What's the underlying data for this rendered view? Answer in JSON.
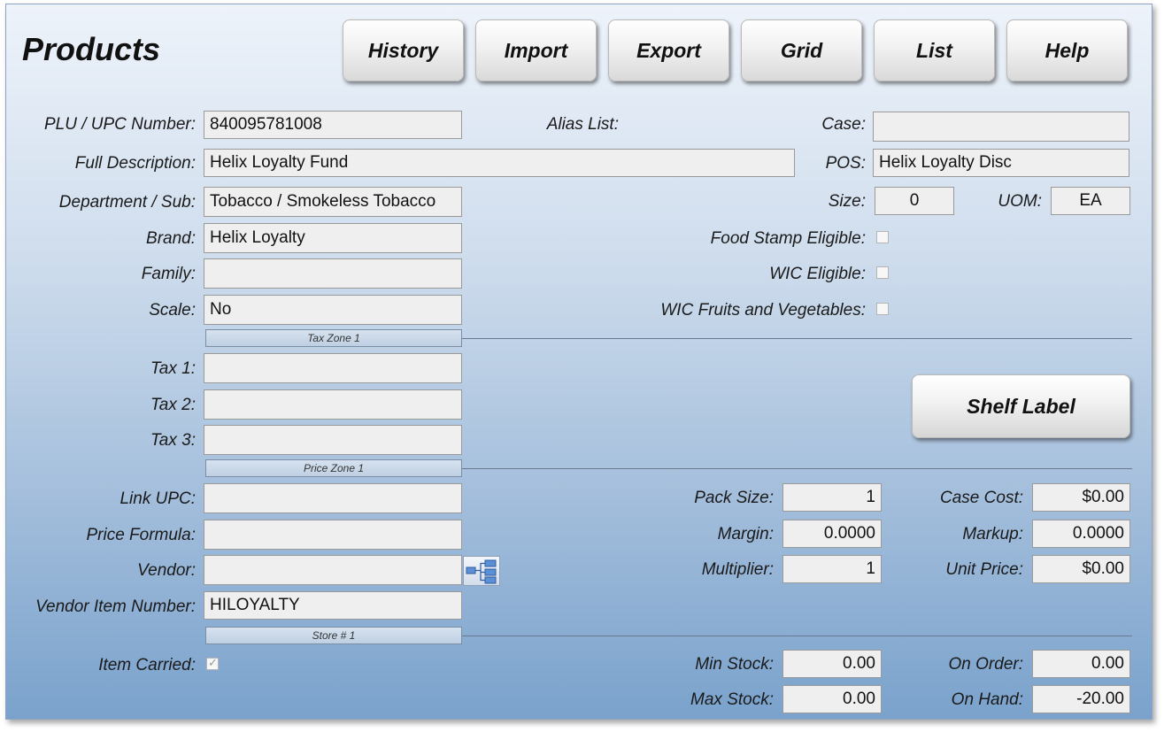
{
  "header": {
    "title": "Products",
    "buttons": {
      "history": "History",
      "import": "Import",
      "export": "Export",
      "grid": "Grid",
      "list": "List",
      "help": "Help"
    }
  },
  "product": {
    "plu_label": "PLU / UPC Number:",
    "plu_value": "840095781008",
    "alias_label": "Alias List:",
    "case_label": "Case:",
    "case_value": "",
    "full_desc_label": "Full Description:",
    "full_desc_value": "Helix Loyalty Fund",
    "pos_label": "POS:",
    "pos_value": "Helix Loyalty Disc",
    "dept_label": "Department / Sub:",
    "dept_value": "Tobacco / Smokeless Tobacco",
    "size_label": "Size:",
    "size_value": "0",
    "uom_label": "UOM:",
    "uom_value": "EA",
    "brand_label": "Brand:",
    "brand_value": "Helix Loyalty",
    "family_label": "Family:",
    "family_value": "",
    "scale_label": "Scale:",
    "scale_value": "No",
    "food_stamp_label": "Food Stamp Eligible:",
    "food_stamp_checked": false,
    "wic_label": "WIC Eligible:",
    "wic_checked": false,
    "wic_fruits_label": "WIC Fruits and Vegetables:",
    "wic_fruits_checked": false
  },
  "tax": {
    "zone_label": "Tax Zone 1",
    "tax1_label": "Tax 1:",
    "tax1_value": "",
    "tax2_label": "Tax 2:",
    "tax2_value": "",
    "tax3_label": "Tax 3:",
    "tax3_value": "",
    "shelf_label_button": "Shelf Label"
  },
  "price": {
    "zone_label": "Price Zone 1",
    "link_upc_label": "Link UPC:",
    "link_upc_value": "",
    "price_formula_label": "Price Formula:",
    "price_formula_value": "",
    "vendor_label": "Vendor:",
    "vendor_value": "",
    "vendor_item_label": "Vendor Item Number:",
    "vendor_item_value": "HILOYALTY",
    "pack_size_label": "Pack Size:",
    "pack_size_value": "1",
    "margin_label": "Margin:",
    "margin_value": "0.0000",
    "multiplier_label": "Multiplier:",
    "multiplier_value": "1",
    "case_cost_label": "Case Cost:",
    "case_cost_value": "$0.00",
    "markup_label": "Markup:",
    "markup_value": "0.0000",
    "unit_price_label": "Unit Price:",
    "unit_price_value": "$0.00"
  },
  "store": {
    "zone_label": "Store # 1",
    "item_carried_label": "Item Carried:",
    "item_carried_checked": true,
    "min_stock_label": "Min Stock:",
    "min_stock_value": "0.00",
    "max_stock_label": "Max Stock:",
    "max_stock_value": "0.00",
    "on_order_label": "On Order:",
    "on_order_value": "0.00",
    "on_hand_label": "On Hand:",
    "on_hand_value": "-20.00"
  }
}
